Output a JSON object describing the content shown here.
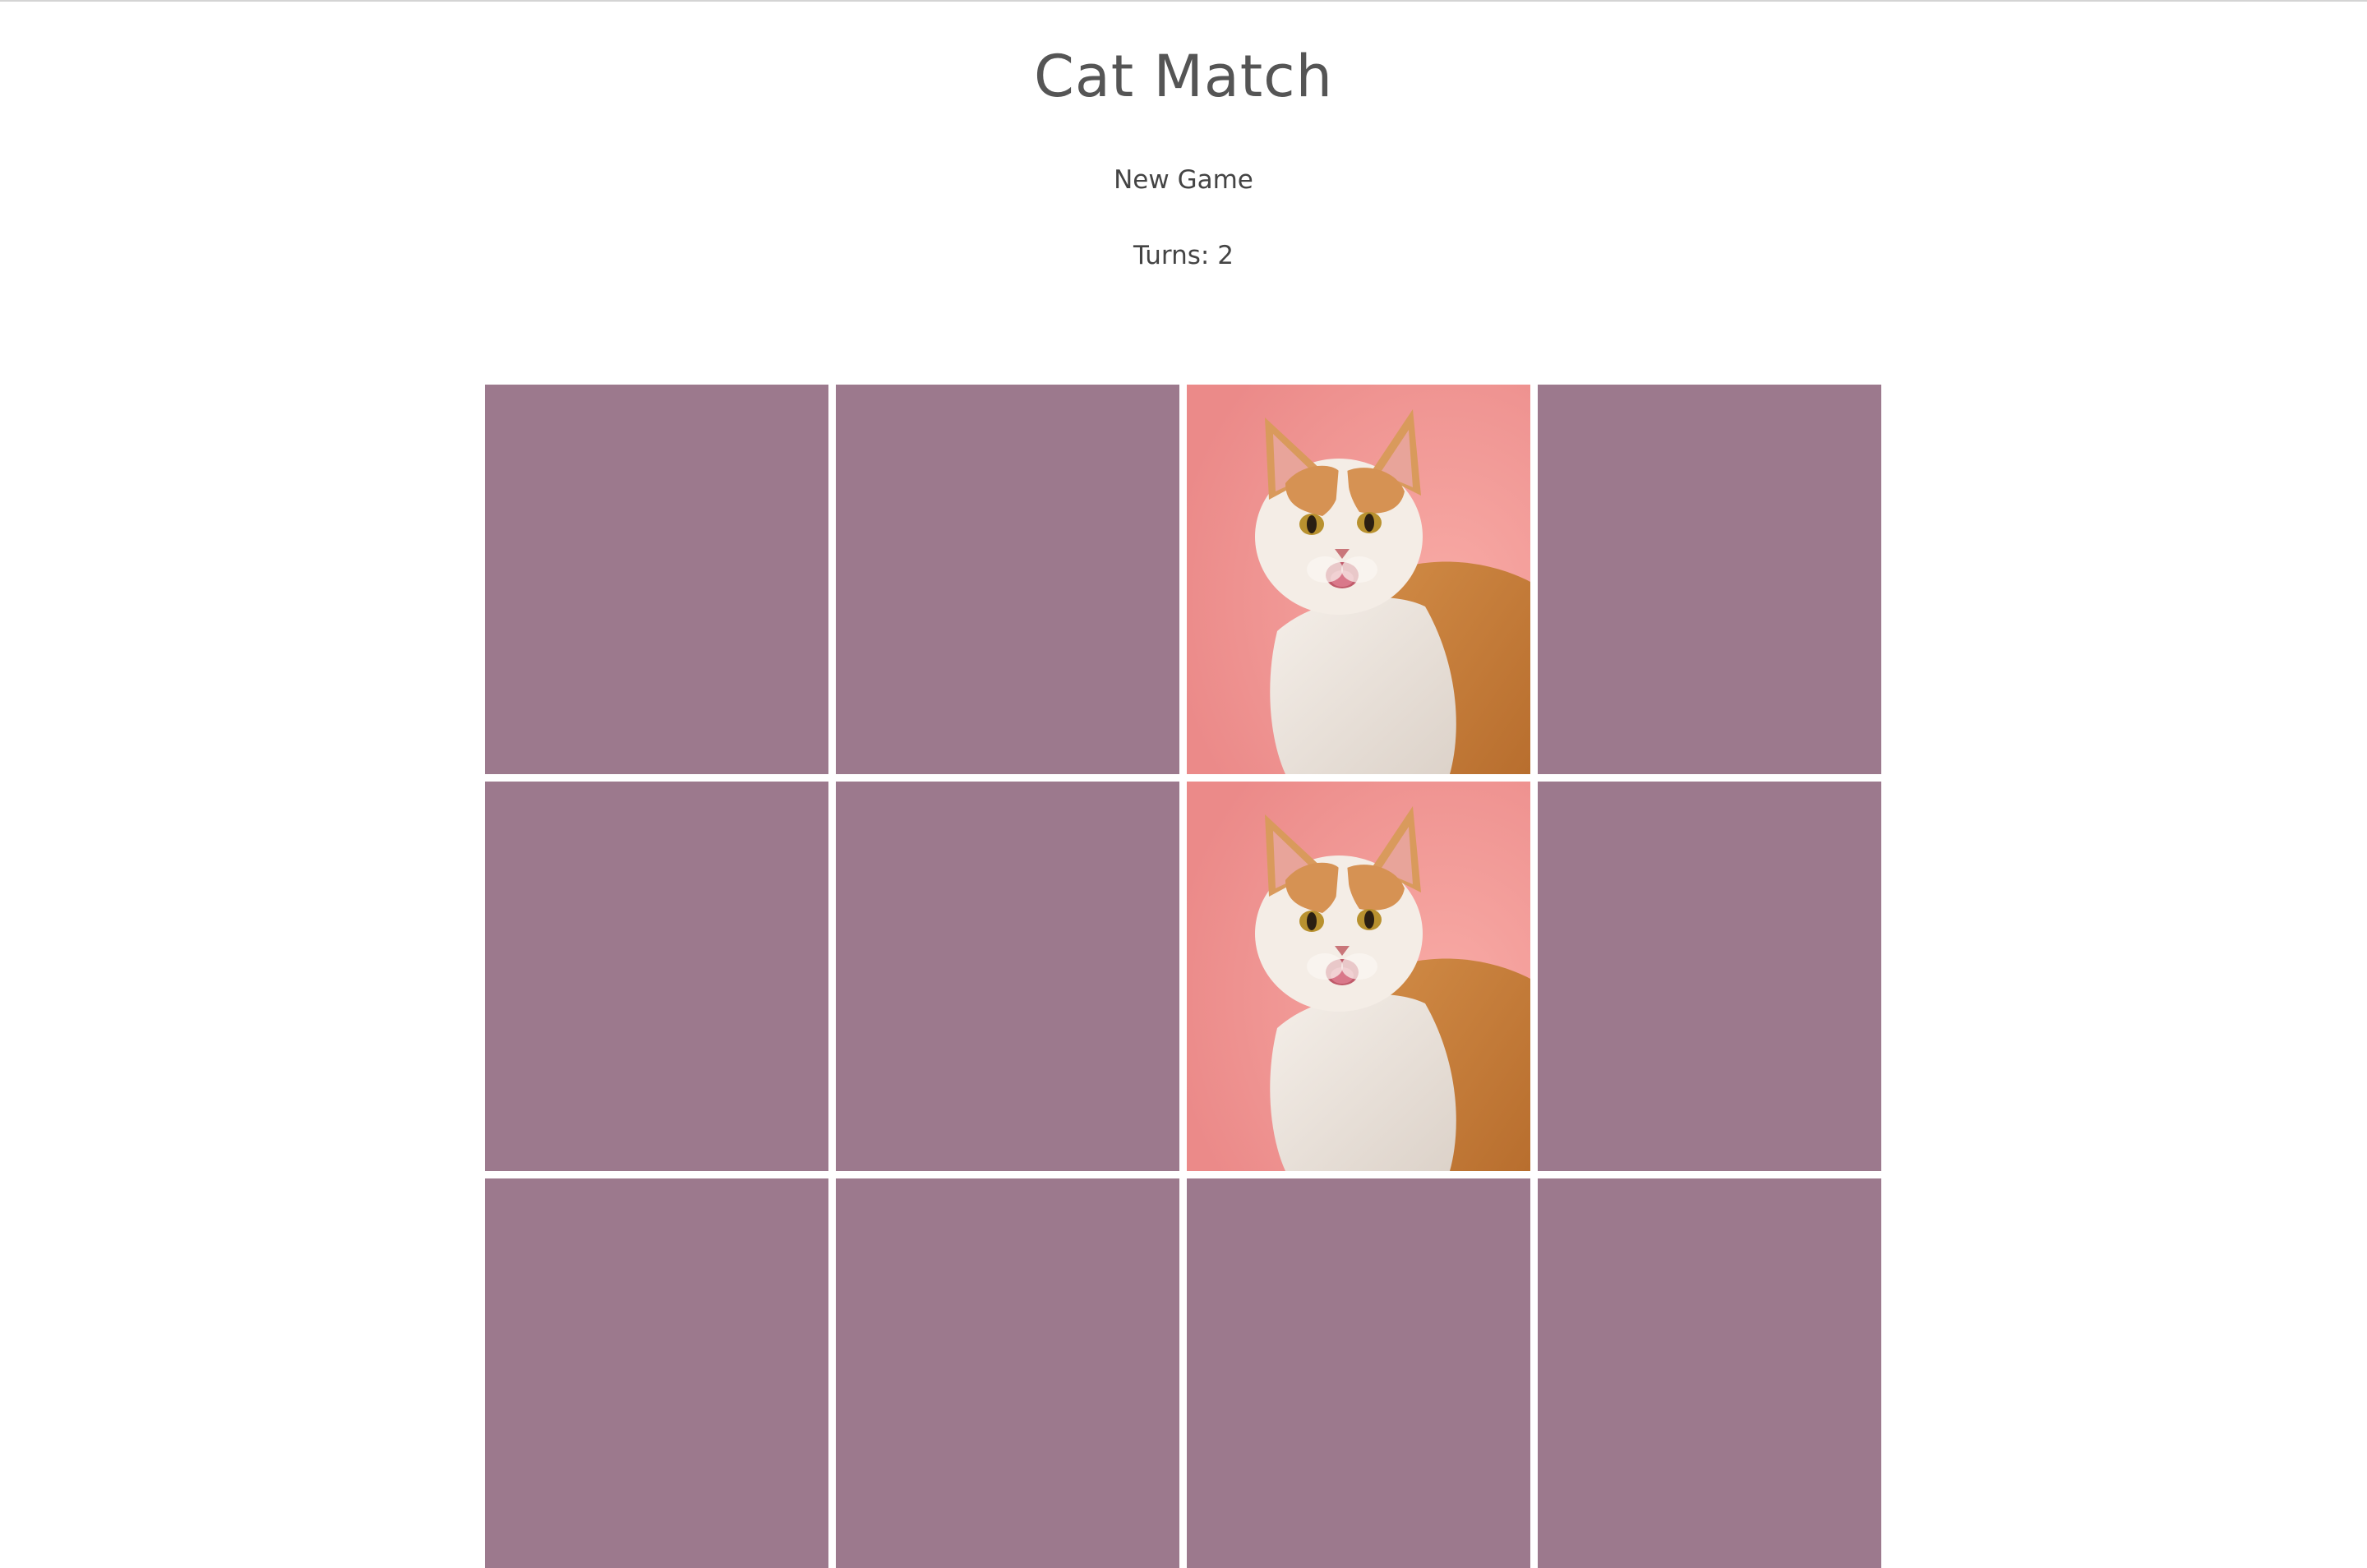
{
  "app": {
    "title": "Cat Match",
    "new_game_label": "New Game",
    "turns_label": "Turns: 2"
  },
  "colors": {
    "card_back": "#9c798d",
    "cat_background": "#f39c98",
    "text": "#4a4a4a"
  },
  "board": {
    "rows": 3,
    "columns": 4,
    "cards": [
      {
        "state": "face-down",
        "image": ""
      },
      {
        "state": "face-down",
        "image": ""
      },
      {
        "state": "face-up",
        "image": "cat-licking-lips-icon"
      },
      {
        "state": "face-down",
        "image": ""
      },
      {
        "state": "face-down",
        "image": ""
      },
      {
        "state": "face-down",
        "image": ""
      },
      {
        "state": "face-up",
        "image": "cat-licking-lips-icon"
      },
      {
        "state": "face-down",
        "image": ""
      },
      {
        "state": "face-down",
        "image": ""
      },
      {
        "state": "face-down",
        "image": ""
      },
      {
        "state": "face-down",
        "image": ""
      },
      {
        "state": "face-down",
        "image": ""
      }
    ]
  }
}
